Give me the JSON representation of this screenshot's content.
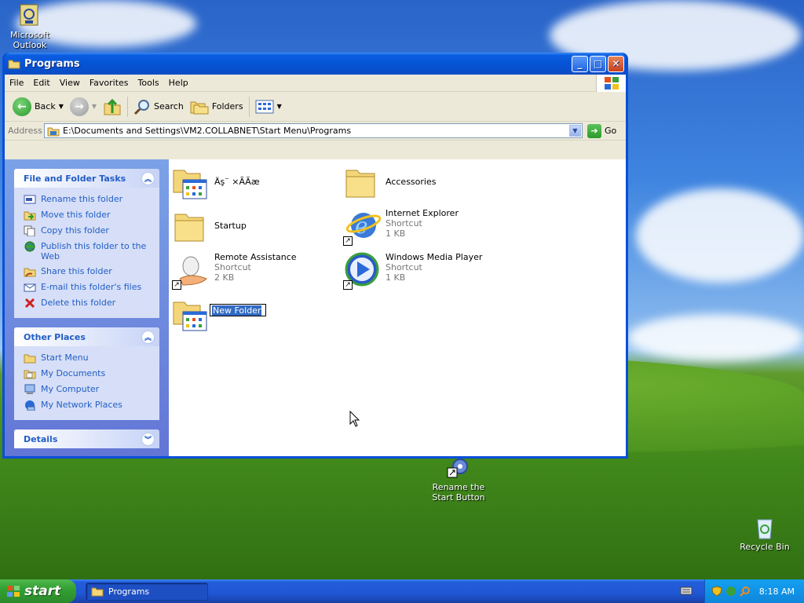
{
  "desktop": {
    "icons": {
      "outlook": "Microsoft Outlook",
      "rename_start": "Rename the Start Button",
      "recycle": "Recycle Bin"
    }
  },
  "window": {
    "title": "Programs",
    "menu": [
      "File",
      "Edit",
      "View",
      "Favorites",
      "Tools",
      "Help"
    ],
    "toolbar": {
      "back": "Back",
      "search": "Search",
      "folders": "Folders"
    },
    "address": {
      "label": "Address",
      "path": "E:\\Documents and Settings\\VM2.COLLABNET\\Start Menu\\Programs",
      "go": "Go"
    }
  },
  "taskpane": {
    "file_tasks": {
      "title": "File and Folder Tasks",
      "items": [
        "Rename this folder",
        "Move this folder",
        "Copy this folder",
        "Publish this folder to the Web",
        "Share this folder",
        "E-mail this folder's files",
        "Delete this folder"
      ]
    },
    "other_places": {
      "title": "Other Places",
      "items": [
        "Start Menu",
        "My Documents",
        "My Computer",
        "My Network Places"
      ]
    },
    "details": {
      "title": "Details"
    }
  },
  "files": [
    {
      "name": "Äş¨ ×ÃÃæ",
      "kind": "program-folder"
    },
    {
      "name": "Accessories",
      "kind": "folder"
    },
    {
      "name": "Startup",
      "kind": "folder"
    },
    {
      "name": "Internet Explorer",
      "type": "Shortcut",
      "size": "1 KB",
      "kind": "ie"
    },
    {
      "name": "Remote Assistance",
      "type": "Shortcut",
      "size": "2 KB",
      "kind": "remote"
    },
    {
      "name": "Windows Media Player",
      "type": "Shortcut",
      "size": "1 KB",
      "kind": "wmp"
    },
    {
      "name": "New Folder",
      "kind": "program-folder-rename"
    }
  ],
  "taskbar": {
    "start": "start",
    "task": "Programs",
    "clock": "8:18 AM"
  },
  "colors": {
    "titlebar": "#0654d6",
    "taskpane": "#6375d6",
    "link": "#215dc6",
    "start": "#33a033"
  }
}
